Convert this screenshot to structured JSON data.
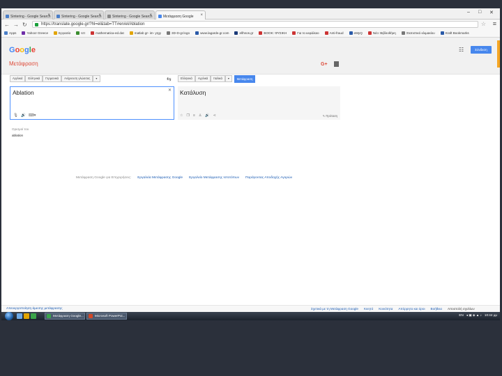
{
  "browser": {
    "tabs": [
      {
        "title": "Sintering - Google Search"
      },
      {
        "title": "Sintering - Google Search"
      },
      {
        "title": "Sintering - Google Search"
      },
      {
        "title": "Μετάφραση Google"
      }
    ],
    "url": "https://translate.google.gr/?hl=el&tab=TT#en/el/Ablation",
    "bookmarks": [
      "Apps",
      "Yahoo! Greece",
      "",
      "Εργασία",
      "",
      "Ιστ",
      "mathematica-ed.dat",
      "",
      "matlab gr- im- yrgy",
      "",
      "3D-D-gr.logo",
      "",
      "www.lagarde.gr.com",
      "",
      "ellhnos.gr",
      "",
      "BOOK: ΦΥΣΙΚΗ",
      "",
      "Για το κεφάλαιο",
      "",
      "Anti-fraud",
      "",
      "eMyQ",
      "",
      "Νέο: Βιβλιοθήκη",
      "",
      "Στατιστικό κλιμακίου",
      "",
      "Kraft Bookmarks"
    ]
  },
  "header": {
    "logo": "Google",
    "subtitle": "Μετάφραση",
    "gplus": "G+",
    "signin": "Σύνδεση"
  },
  "source_langs": [
    "Αγγλικά",
    "Ελληνικά",
    "Γερμανικά",
    "Ανίχνευση γλώσσας"
  ],
  "target_langs": [
    "Ελληνικά",
    "Αγγλικά",
    "Ιταλικά"
  ],
  "translate_label": "Μετάφραση",
  "source_text": "Ablation",
  "target_text": "Κατάλυση",
  "suggest_edit": "Πρόταση",
  "definitions": {
    "title": "Ορισμοί του",
    "word": "ablation"
  },
  "footer_links": [
    {
      "text": "Μετάφραση Google για Επιχειρήσεις:",
      "plain": true
    },
    {
      "text": "Εργαλεία Μετάφρασης Google"
    },
    {
      "text": "Εργαλείο Μετάφρασης Ιστοτόπων"
    },
    {
      "text": "Παράγοντας Αποδοχής Αγορών"
    }
  ],
  "bottom_bar": {
    "left": "Απενεργοποίηση άμεσης μετάφρασης",
    "right": [
      {
        "text": "Σχετικά με τη Μετάφραση Google"
      },
      {
        "text": "Κινητό"
      },
      {
        "text": "Κοινότητα"
      },
      {
        "text": "Απόρρητο και όροι"
      },
      {
        "text": "Βοήθεια"
      },
      {
        "text": "Αποστολή σχολίων",
        "plain": true
      }
    ]
  },
  "taskbar": {
    "tasks": [
      "Μετάφραση Google...",
      "Microsoft PowerPoi..."
    ],
    "tray_lang": "EN",
    "clock": "10:44 μμ"
  },
  "colors": {
    "accent": "#4787ed",
    "brand_red": "#dd4b39",
    "desktop": "#2b303b"
  }
}
